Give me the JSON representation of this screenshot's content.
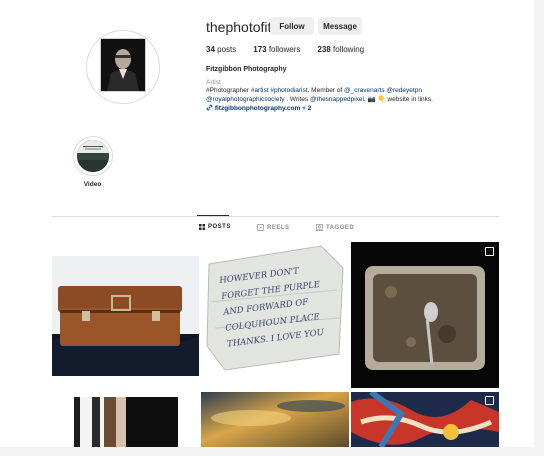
{
  "profile": {
    "username": "thephotofitz",
    "follow_label": "Follow",
    "message_label": "Message",
    "posts_count": "34",
    "posts_label": " posts",
    "followers_count": "173",
    "followers_label": " followers",
    "following_count": "238",
    "following_label": " following",
    "full_name": "Fitzgibbon Photography",
    "category": "Artist",
    "bio": {
      "line1_a": "#Photographer ",
      "line1_tag1": "#artist",
      "line1_sp": " ",
      "line1_tag2": "#photodiarist",
      "line1_b": ". Member of ",
      "line1_tag3": "@_cravenarts",
      "line1_sp2": " ",
      "line1_tag4": "@redeyetpn",
      "line2_tag1": "@royalphotographicsociety",
      "line2_b": " . Writes ",
      "line2_tag2": "@thesnappedpixel",
      "line2_c": ". 📷 👇 website in links."
    },
    "link": "fitzgibbonphotography.com + 2"
  },
  "highlights": [
    {
      "label": "Video"
    }
  ],
  "tabs": [
    {
      "label": "POSTS",
      "icon": "grid-icon",
      "active": true
    },
    {
      "label": "REELS",
      "icon": "reels-icon",
      "active": false
    },
    {
      "label": "TAGGED",
      "icon": "tagged-icon",
      "active": false
    }
  ],
  "posts": [
    {
      "subject": "suitcase-photo"
    },
    {
      "subject": "handwritten-note-photo",
      "note_text": "HOWEVER DON'T FORGET THE PURPLE AND FORWARD OF COLQUHOUN PLACE THANKS. I LOVE YOU"
    },
    {
      "subject": "spoon-in-tray-photo",
      "multi": true
    },
    {
      "subject": "blurred-window-photo"
    },
    {
      "subject": "sunset-sky-photo"
    },
    {
      "subject": "abstract-painting-photo",
      "multi": true
    }
  ],
  "colors": {
    "link": "#00376b",
    "text": "#262626",
    "muted": "#8e8e8e",
    "button_bg": "#efefef"
  }
}
